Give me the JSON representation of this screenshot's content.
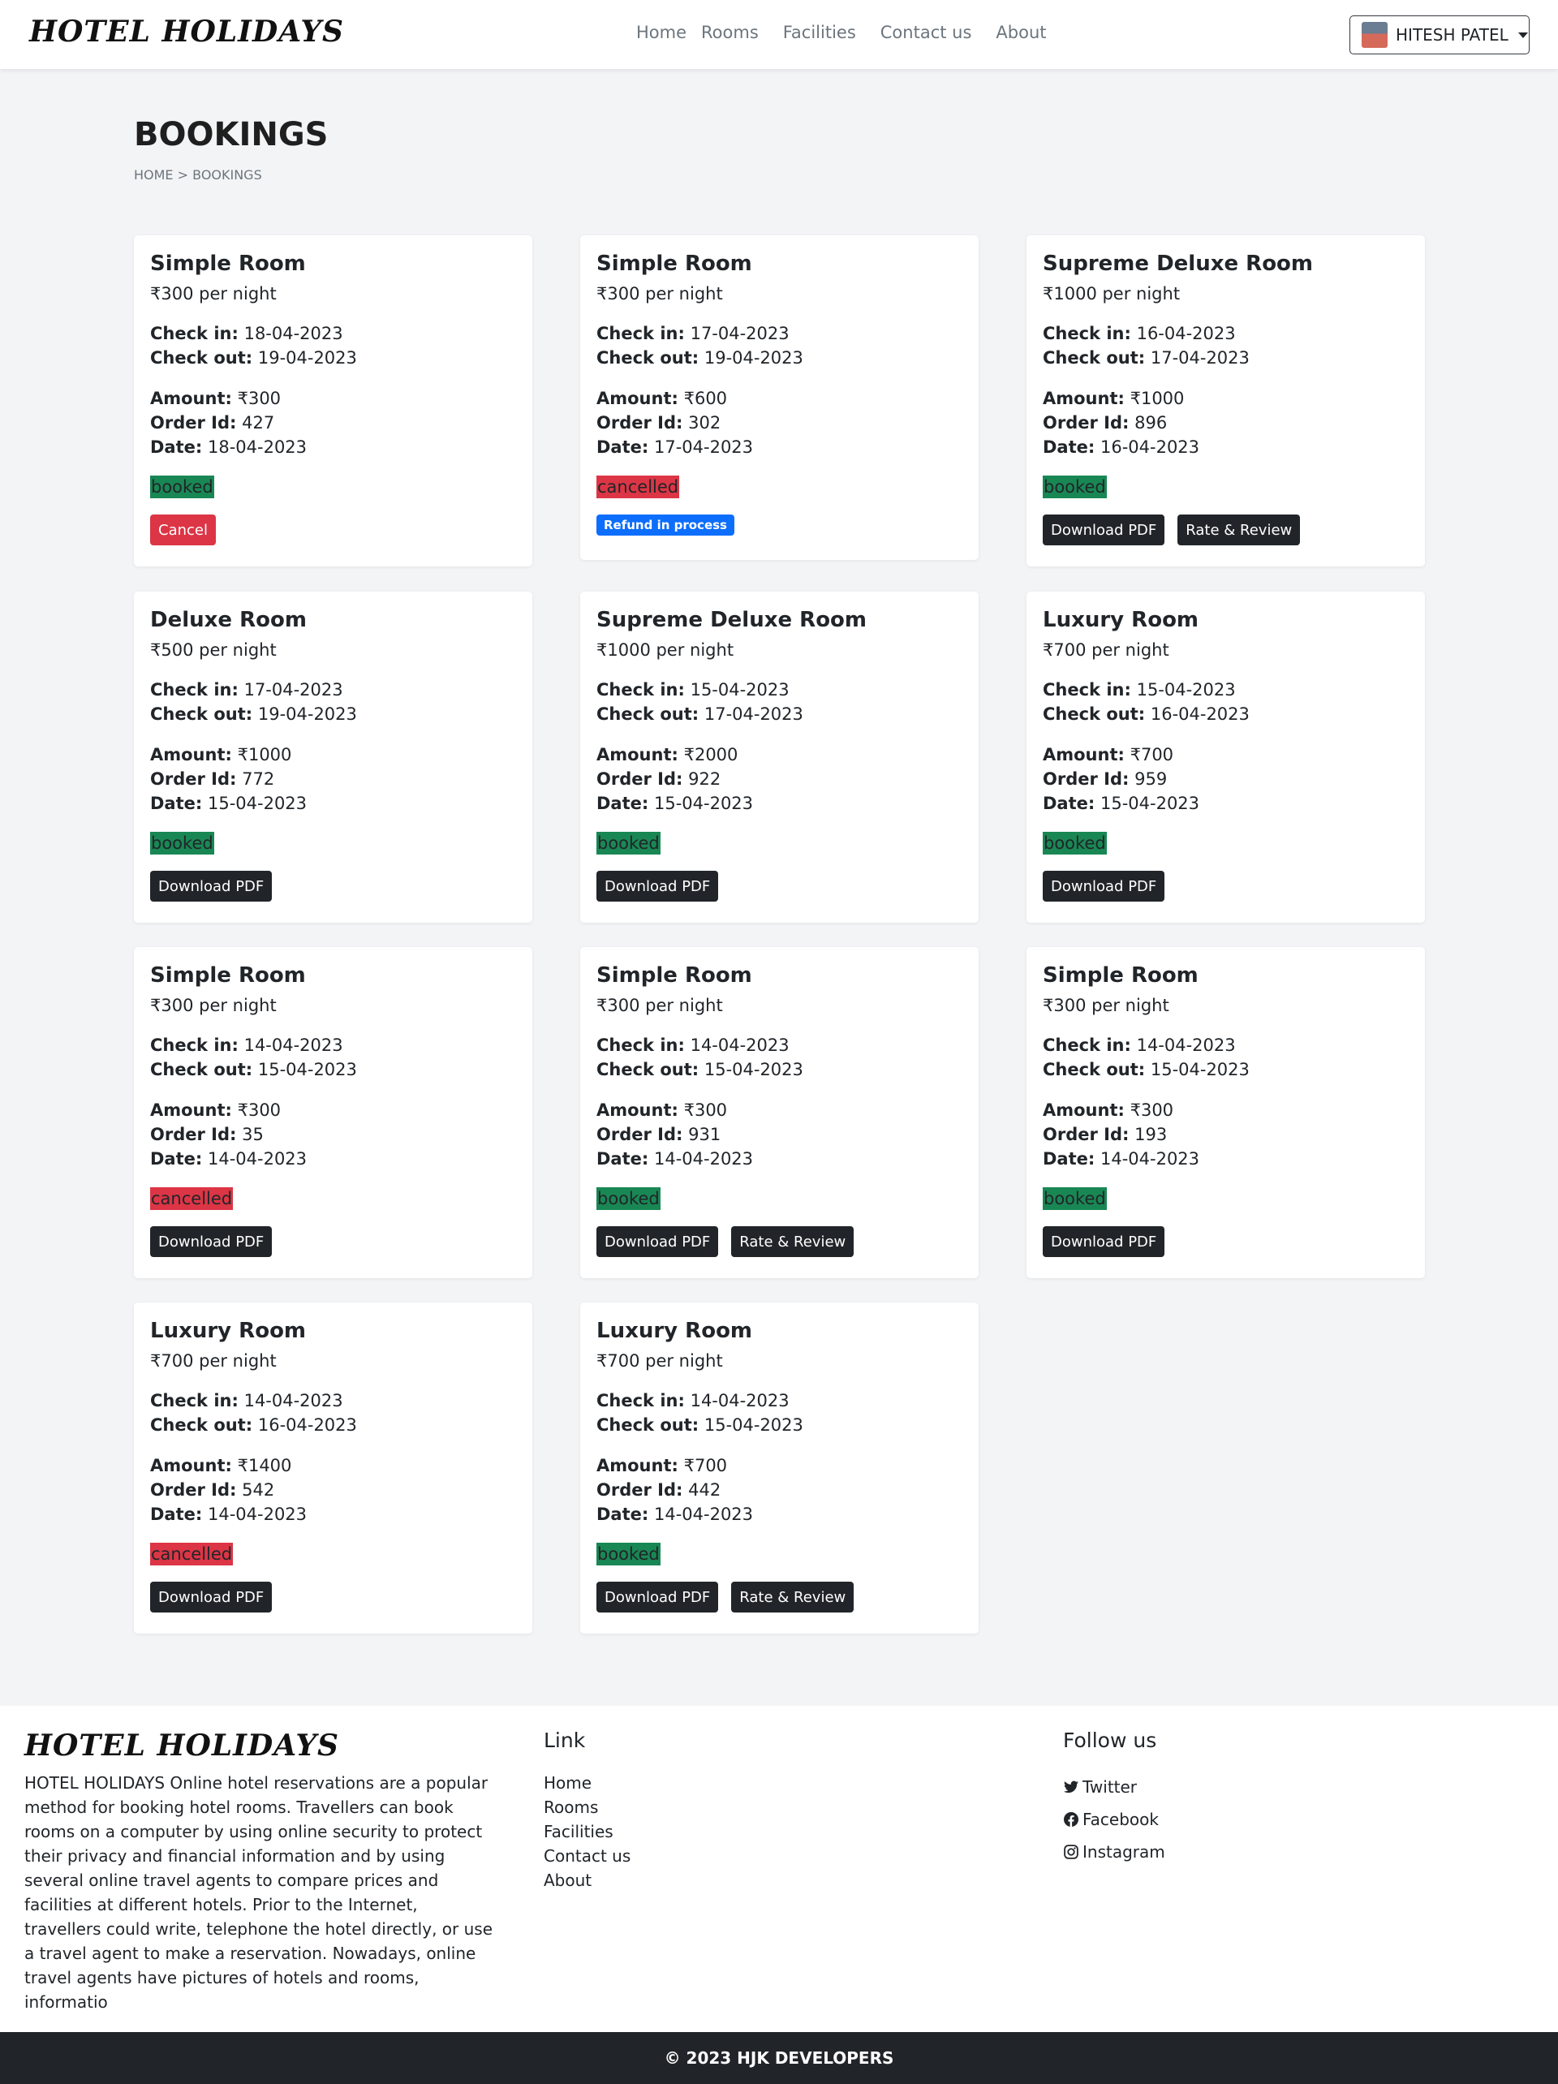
{
  "nav": {
    "brand": "HOTEL HOLIDAYS",
    "links": [
      "Home",
      "Rooms",
      "Facilities",
      "Contact us",
      "About"
    ],
    "user": "HITESH PATEL"
  },
  "page": {
    "title": "BOOKINGS",
    "breadcrumb": "HOME > BOOKINGS"
  },
  "labels": {
    "check_in": "Check in:",
    "check_out": "Check out:",
    "amount": "Amount:",
    "order_id": "Order Id:",
    "date": "Date:"
  },
  "bookings": [
    {
      "room": "Simple Room",
      "price": "₹300 per night",
      "check_in": "18-04-2023",
      "check_out": "19-04-2023",
      "amount": "₹300",
      "order_id": "427",
      "date": "18-04-2023",
      "status": "booked",
      "buttons": [
        "Cancel"
      ],
      "badge": ""
    },
    {
      "room": "Simple Room",
      "price": "₹300 per night",
      "check_in": "17-04-2023",
      "check_out": "19-04-2023",
      "amount": "₹600",
      "order_id": "302",
      "date": "17-04-2023",
      "status": "cancelled",
      "buttons": [],
      "badge": "Refund in process"
    },
    {
      "room": "Supreme Deluxe Room",
      "price": "₹1000 per night",
      "check_in": "16-04-2023",
      "check_out": "17-04-2023",
      "amount": "₹1000",
      "order_id": "896",
      "date": "16-04-2023",
      "status": "booked",
      "buttons": [
        "Download PDF",
        "Rate & Review"
      ],
      "badge": ""
    },
    {
      "room": "Deluxe Room",
      "price": "₹500 per night",
      "check_in": "17-04-2023",
      "check_out": "19-04-2023",
      "amount": "₹1000",
      "order_id": "772",
      "date": "15-04-2023",
      "status": "booked",
      "buttons": [
        "Download PDF"
      ],
      "badge": ""
    },
    {
      "room": "Supreme Deluxe Room",
      "price": "₹1000 per night",
      "check_in": "15-04-2023",
      "check_out": "17-04-2023",
      "amount": "₹2000",
      "order_id": "922",
      "date": "15-04-2023",
      "status": "booked",
      "buttons": [
        "Download PDF"
      ],
      "badge": ""
    },
    {
      "room": "Luxury Room",
      "price": "₹700 per night",
      "check_in": "15-04-2023",
      "check_out": "16-04-2023",
      "amount": "₹700",
      "order_id": "959",
      "date": "15-04-2023",
      "status": "booked",
      "buttons": [
        "Download PDF"
      ],
      "badge": ""
    },
    {
      "room": "Simple Room",
      "price": "₹300 per night",
      "check_in": "14-04-2023",
      "check_out": "15-04-2023",
      "amount": "₹300",
      "order_id": "35",
      "date": "14-04-2023",
      "status": "cancelled",
      "buttons": [
        "Download PDF"
      ],
      "badge": ""
    },
    {
      "room": "Simple Room",
      "price": "₹300 per night",
      "check_in": "14-04-2023",
      "check_out": "15-04-2023",
      "amount": "₹300",
      "order_id": "931",
      "date": "14-04-2023",
      "status": "booked",
      "buttons": [
        "Download PDF",
        "Rate & Review"
      ],
      "badge": ""
    },
    {
      "room": "Simple Room",
      "price": "₹300 per night",
      "check_in": "14-04-2023",
      "check_out": "15-04-2023",
      "amount": "₹300",
      "order_id": "193",
      "date": "14-04-2023",
      "status": "booked",
      "buttons": [
        "Download PDF"
      ],
      "badge": ""
    },
    {
      "room": "Luxury Room",
      "price": "₹700 per night",
      "check_in": "14-04-2023",
      "check_out": "16-04-2023",
      "amount": "₹1400",
      "order_id": "542",
      "date": "14-04-2023",
      "status": "cancelled",
      "buttons": [
        "Download PDF"
      ],
      "badge": ""
    },
    {
      "room": "Luxury Room",
      "price": "₹700 per night",
      "check_in": "14-04-2023",
      "check_out": "15-04-2023",
      "amount": "₹700",
      "order_id": "442",
      "date": "14-04-2023",
      "status": "booked",
      "buttons": [
        "Download PDF",
        "Rate & Review"
      ],
      "badge": ""
    }
  ],
  "footer": {
    "brand": "HOTEL HOLIDAYS",
    "description": "HOTEL HOLIDAYS Online hotel reservations are a popular method for booking hotel rooms. Travellers can book rooms on a computer by using online security to protect their privacy and financial information and by using several online travel agents to compare prices and facilities at different hotels. Prior to the Internet, travellers could write, telephone the hotel directly, or use a travel agent to make a reservation. Nowadays, online travel agents have pictures of hotels and rooms, informatio",
    "links_heading": "Link",
    "links": [
      "Home",
      "Rooms",
      "Facilities",
      "Contact us",
      "About"
    ],
    "follow_heading": "Follow us",
    "social": [
      {
        "label": "Twitter",
        "icon": "twitter-icon"
      },
      {
        "label": "Facebook",
        "icon": "facebook-icon"
      },
      {
        "label": "Instagram",
        "icon": "instagram-icon"
      }
    ],
    "copyright": "© 2023 HJK DEVELOPERS"
  },
  "colors": {
    "booked": "#198754",
    "cancelled": "#dc3545",
    "dark": "#212529",
    "refund_badge": "#0d6efd"
  }
}
